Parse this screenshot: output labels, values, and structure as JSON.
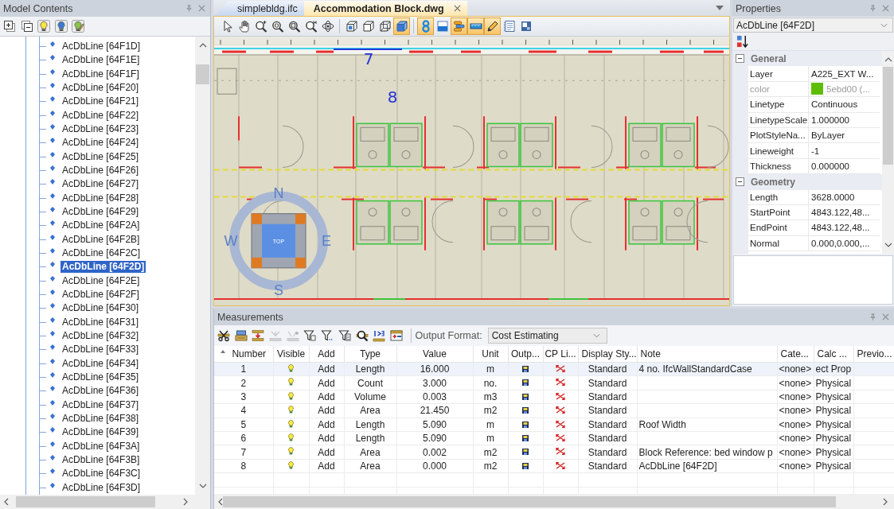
{
  "model_contents": {
    "title": "Model Contents",
    "tree": [
      {
        "label": "AcDbLine [64F1D]",
        "selected": false
      },
      {
        "label": "AcDbLine [64F1E]",
        "selected": false
      },
      {
        "label": "AcDbLine [64F1F]",
        "selected": false
      },
      {
        "label": "AcDbLine [64F20]",
        "selected": false
      },
      {
        "label": "AcDbLine [64F21]",
        "selected": false
      },
      {
        "label": "AcDbLine [64F22]",
        "selected": false
      },
      {
        "label": "AcDbLine [64F23]",
        "selected": false
      },
      {
        "label": "AcDbLine [64F24]",
        "selected": false
      },
      {
        "label": "AcDbLine [64F25]",
        "selected": false
      },
      {
        "label": "AcDbLine [64F26]",
        "selected": false
      },
      {
        "label": "AcDbLine [64F27]",
        "selected": false
      },
      {
        "label": "AcDbLine [64F28]",
        "selected": false
      },
      {
        "label": "AcDbLine [64F29]",
        "selected": false
      },
      {
        "label": "AcDbLine [64F2A]",
        "selected": false
      },
      {
        "label": "AcDbLine [64F2B]",
        "selected": false
      },
      {
        "label": "AcDbLine [64F2C]",
        "selected": false
      },
      {
        "label": "AcDbLine [64F2D]",
        "selected": true
      },
      {
        "label": "AcDbLine [64F2E]",
        "selected": false
      },
      {
        "label": "AcDbLine [64F2F]",
        "selected": false
      },
      {
        "label": "AcDbLine [64F30]",
        "selected": false
      },
      {
        "label": "AcDbLine [64F31]",
        "selected": false
      },
      {
        "label": "AcDbLine [64F32]",
        "selected": false
      },
      {
        "label": "AcDbLine [64F33]",
        "selected": false
      },
      {
        "label": "AcDbLine [64F34]",
        "selected": false
      },
      {
        "label": "AcDbLine [64F35]",
        "selected": false
      },
      {
        "label": "AcDbLine [64F36]",
        "selected": false
      },
      {
        "label": "AcDbLine [64F37]",
        "selected": false
      },
      {
        "label": "AcDbLine [64F38]",
        "selected": false
      },
      {
        "label": "AcDbLine [64F39]",
        "selected": false
      },
      {
        "label": "AcDbLine [64F3A]",
        "selected": false
      },
      {
        "label": "AcDbLine [64F3B]",
        "selected": false
      },
      {
        "label": "AcDbLine [64F3C]",
        "selected": false
      },
      {
        "label": "AcDbLine [64F3D]",
        "selected": false
      }
    ]
  },
  "document_tabs": [
    {
      "label": "simplebldg.ifc",
      "selected": false
    },
    {
      "label": "Accommodation Block.dwg",
      "selected": true
    }
  ],
  "view_toolbar": [
    {
      "buttons": [
        {
          "active": false
        },
        {
          "active": false
        },
        {
          "active": false
        },
        {
          "active": false
        },
        {
          "active": false
        },
        {
          "active": false
        },
        {
          "active": false
        }
      ]
    },
    {
      "buttons": [
        {
          "active": false
        },
        {
          "active": false
        },
        {
          "active": false
        },
        {
          "active": true
        }
      ]
    },
    {
      "buttons": [
        {
          "active": true
        },
        {
          "active": false
        },
        {
          "active": true
        },
        {
          "active": true
        },
        {
          "active": true
        },
        {
          "active": false
        },
        {
          "active": false
        }
      ]
    }
  ],
  "drawing": {
    "grid_labels": [
      "7",
      "8"
    ],
    "compass": {
      "north": "N",
      "east": "E",
      "south": "S",
      "west": "W",
      "cube_face": "TOP"
    }
  },
  "properties": {
    "title": "Properties",
    "selector": "AcDbLine [64F2D]",
    "categories": [
      {
        "name": "General",
        "expanded": true,
        "rows": [
          {
            "name": "Layer",
            "value": "A225_EXT W...",
            "disabled": false
          },
          {
            "name": "color",
            "value": "5ebd00 (...",
            "disabled": true,
            "color": "#5ebd00"
          },
          {
            "name": "Linetype",
            "value": "Continuous",
            "disabled": false
          },
          {
            "name": "LinetypeScale",
            "value": "1.000000",
            "disabled": false
          },
          {
            "name": "PlotStyleNa...",
            "value": "ByLayer",
            "disabled": false
          },
          {
            "name": "Lineweight",
            "value": "-1",
            "disabled": false
          },
          {
            "name": "Thickness",
            "value": "0.000000",
            "disabled": false
          }
        ]
      },
      {
        "name": "Geometry",
        "expanded": true,
        "rows": [
          {
            "name": "Length",
            "value": "3628.0000",
            "disabled": false
          },
          {
            "name": "StartPoint",
            "value": "4843.122,48...",
            "disabled": false
          },
          {
            "name": "EndPoint",
            "value": "4843.122,48...",
            "disabled": false
          },
          {
            "name": "Normal",
            "value": "0.000,0.000,...",
            "disabled": false
          }
        ]
      }
    ]
  },
  "measurements": {
    "title": "Measurements",
    "toolbar": [
      {
        "disabled": false
      },
      {
        "disabled": false
      },
      {
        "disabled": false
      },
      {
        "disabled": true
      },
      {
        "disabled": true
      },
      {
        "disabled": false
      },
      {
        "disabled": false
      },
      {
        "disabled": false
      },
      {
        "disabled": false
      },
      {
        "disabled": false
      },
      {
        "disabled": false
      }
    ],
    "output_format": {
      "label": "Output Format:",
      "value": "Cost Estimating"
    },
    "columns": [
      {
        "label": "Number",
        "sorted": true
      },
      {
        "label": "Visible",
        "sorted": false
      },
      {
        "label": "Add",
        "sorted": false
      },
      {
        "label": "Type",
        "sorted": false
      },
      {
        "label": "Value",
        "sorted": false
      },
      {
        "label": "Unit",
        "sorted": false
      },
      {
        "label": "Outp...",
        "sorted": false
      },
      {
        "label": "CP Li...",
        "sorted": false
      },
      {
        "label": "Display Sty...",
        "sorted": false
      },
      {
        "label": "Note",
        "sorted": false
      },
      {
        "label": "Cate...",
        "sorted": false
      },
      {
        "label": "Calc ...",
        "sorted": false
      },
      {
        "label": "Previo...",
        "sorted": false
      }
    ],
    "rows": [
      {
        "selected": true,
        "number": "1",
        "visible": true,
        "add": "Add",
        "type": "Length",
        "value": "16.000",
        "unit": "m",
        "display_style": "Standard",
        "note": "4 no. IfcWallStandardCase",
        "cate": "<none>",
        "calc": "ect Prop"
      },
      {
        "selected": false,
        "number": "2",
        "visible": true,
        "add": "Add",
        "type": "Count",
        "value": "3.000",
        "unit": "no.",
        "display_style": "Standard",
        "cate": "<none>",
        "calc": "Physical"
      },
      {
        "selected": false,
        "number": "3",
        "visible": true,
        "add": "Add",
        "type": "Volume",
        "value": "0.003",
        "unit": "m3",
        "display_style": "Standard",
        "cate": "<none>",
        "calc": "Physical"
      },
      {
        "selected": false,
        "number": "4",
        "visible": true,
        "add": "Add",
        "type": "Area",
        "value": "21.450",
        "unit": "m2",
        "display_style": "Standard",
        "cate": "<none>",
        "calc": "Physical"
      },
      {
        "selected": false,
        "number": "5",
        "visible": true,
        "add": "Add",
        "type": "Length",
        "value": "5.090",
        "unit": "m",
        "display_style": "Standard",
        "note": "Roof Width",
        "cate": "<none>",
        "calc": "Physical"
      },
      {
        "selected": false,
        "number": "6",
        "visible": true,
        "add": "Add",
        "type": "Length",
        "value": "5.090",
        "unit": "m",
        "display_style": "Standard",
        "cate": "<none>",
        "calc": "Physical"
      },
      {
        "selected": false,
        "number": "7",
        "visible": true,
        "add": "Add",
        "type": "Area",
        "value": "0.002",
        "unit": "m2",
        "display_style": "Standard",
        "note": "Block Reference: bed window p",
        "cate": "<none>",
        "calc": "Physical"
      },
      {
        "selected": false,
        "number": "8",
        "visible": true,
        "add": "Add",
        "type": "Area",
        "value": "0.000",
        "unit": "m2",
        "display_style": "Standard",
        "note": "AcDbLine [64F2D]",
        "cate": "<none>",
        "calc": "Physical"
      }
    ]
  }
}
